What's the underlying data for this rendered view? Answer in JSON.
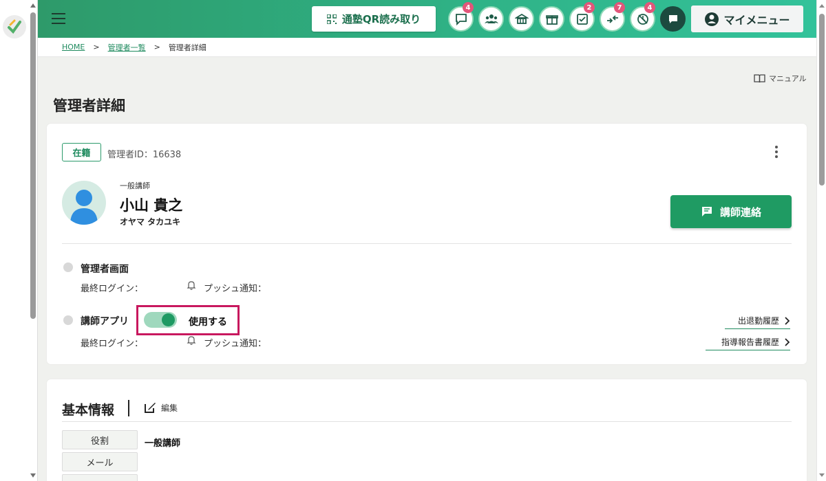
{
  "header": {
    "qr_button_label": "通塾QR読み取り",
    "icons": [
      {
        "name": "message-icon",
        "badge": "4"
      },
      {
        "name": "group-icon",
        "badge": ""
      },
      {
        "name": "school-icon",
        "badge": ""
      },
      {
        "name": "gift-icon",
        "badge": ""
      },
      {
        "name": "checklist-icon",
        "badge": "2"
      },
      {
        "name": "transfer-icon",
        "badge": "7"
      },
      {
        "name": "clock-check-icon",
        "badge": "4"
      },
      {
        "name": "chat-icon",
        "badge": ""
      }
    ],
    "mymenu_label": "マイメニュー"
  },
  "breadcrumb": {
    "home": "HOME",
    "sep1": ">",
    "admin_list": "管理者一覧",
    "sep2": ">",
    "current": "管理者詳細"
  },
  "manual_label": "マニュアル",
  "page_title": "管理者詳細",
  "profile": {
    "status": "在籍",
    "admin_id": "管理者ID：16638",
    "role": "一般講師",
    "name": "小山 貴之",
    "kana": "オヤマ タカユキ",
    "contact_button": "講師連絡"
  },
  "admin_screen": {
    "label": "管理者画面",
    "last_login": "最終ログイン：",
    "push": "プッシュ通知："
  },
  "teacher_app": {
    "label": "講師アプリ",
    "toggle_state": "on",
    "toggle_label": "使用する",
    "last_login": "最終ログイン：",
    "push": "プッシュ通知：",
    "link_attendance": "出退勤履歴",
    "link_report": "指導報告書履歴"
  },
  "basic_info": {
    "title": "基本情報",
    "edit_label": "編集",
    "fields": [
      {
        "label": "役割",
        "value": "一般講師"
      },
      {
        "label": "メール",
        "value": ""
      }
    ]
  },
  "colors": {
    "brand_green": "#1f9b63",
    "badge_pink": "#e2567a",
    "highlight_box": "#c8185e"
  }
}
